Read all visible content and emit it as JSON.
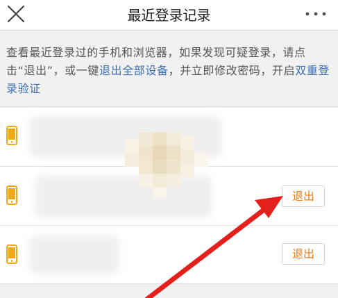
{
  "navbar": {
    "title": "最近登录记录",
    "close_icon": "close-icon",
    "more_icon": "more-dots-icon"
  },
  "notice": {
    "text_before_link1": "查看最近登录过的手机和浏览器，如果发现可疑登录，请点击“退出”，或一键",
    "link1": "退出全部设备",
    "text_between": "，并立即修改密码，开启",
    "link2": "双重登录验证"
  },
  "devices": [
    {
      "device_icon": "phone-icon",
      "action_label": ""
    },
    {
      "device_icon": "phone-icon",
      "action_label": "退出"
    },
    {
      "device_icon": "phone-icon",
      "action_label": "退出"
    }
  ],
  "colors": {
    "accent_orange": "#ec7b1a",
    "icon_orange": "#f2a71b",
    "link_blue": "#3a6fb5",
    "arrow_red": "#e3201b"
  }
}
